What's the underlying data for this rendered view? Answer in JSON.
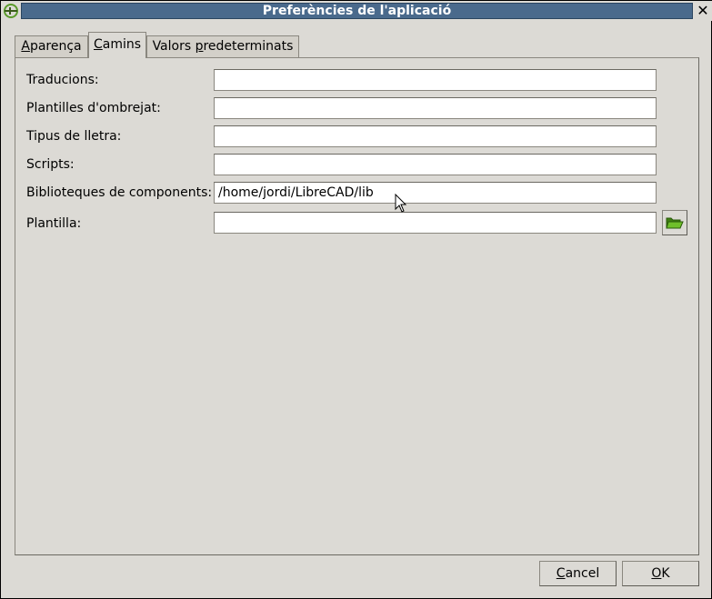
{
  "window": {
    "title": "Preferències de l'aplicació",
    "close_glyph": "✕"
  },
  "tabs": [
    {
      "label_prefix": "",
      "label_ul": "A",
      "label_rest": "parença",
      "active": false
    },
    {
      "label_prefix": "",
      "label_ul": "C",
      "label_rest": "amins",
      "active": true
    },
    {
      "label_prefix": "Valors ",
      "label_ul": "p",
      "label_rest": "redeterminats",
      "active": false
    }
  ],
  "paths": {
    "translations_label": "Traducions:",
    "translations_value": "",
    "hatch_label": "Plantilles d'ombrejat:",
    "hatch_value": "",
    "fonts_label": "Tipus de lletra:",
    "fonts_value": "",
    "scripts_label": "Scripts:",
    "scripts_value": "",
    "libraries_label": "Biblioteques de components:",
    "libraries_value": "/home/jordi/LibreCAD/lib",
    "template_label": "Plantilla:",
    "template_value": "",
    "browse_icon": "folder-open-icon"
  },
  "buttons": {
    "cancel_ul": "C",
    "cancel_rest": "ancel",
    "ok_ul": "O",
    "ok_rest": "K"
  },
  "colors": {
    "titlebar": "#4a6a8c",
    "background": "#dcdad5",
    "folder": "#6fbf2a"
  }
}
